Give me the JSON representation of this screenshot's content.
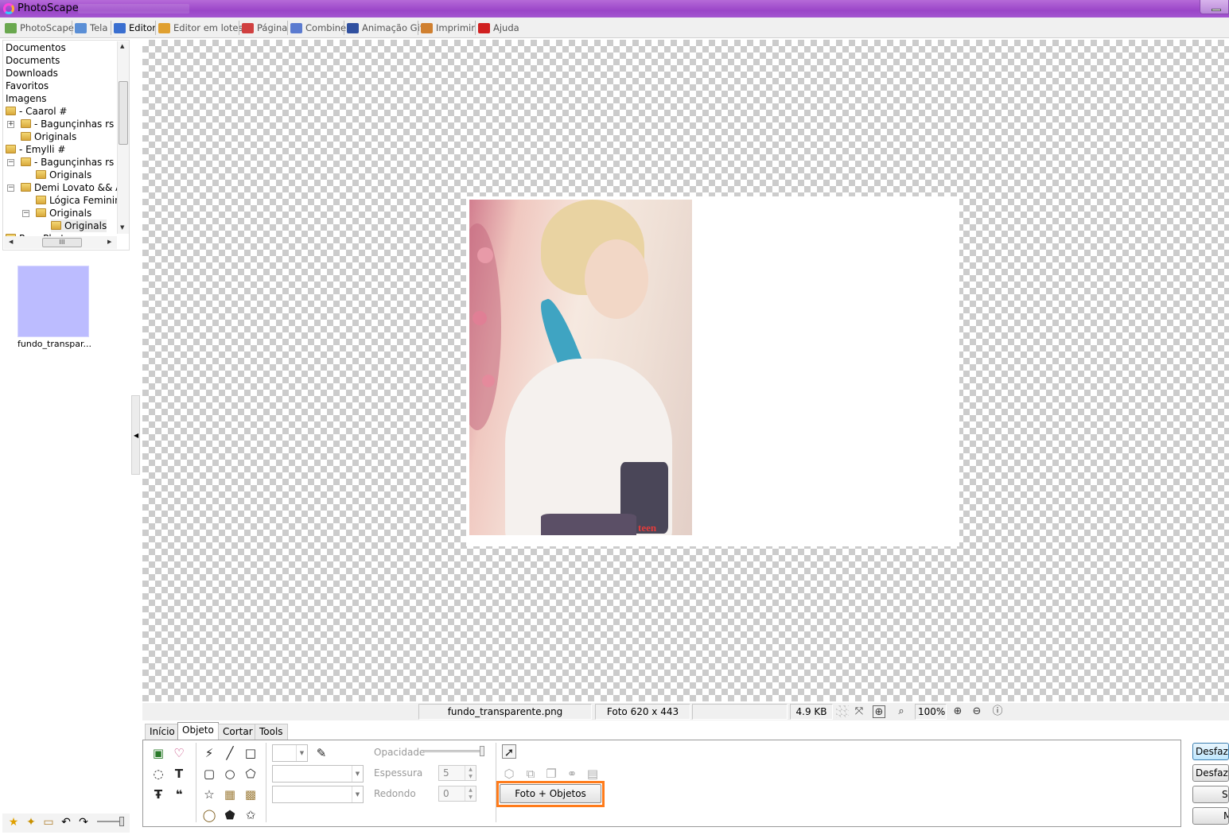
{
  "window": {
    "title": "PhotoScape"
  },
  "tabs": [
    {
      "label": "PhotoScape",
      "icon": "photoscape-icon",
      "color": "#6aa84f"
    },
    {
      "label": "Tela",
      "icon": "viewer-icon",
      "color": "#5b8fd6"
    },
    {
      "label": "Editor",
      "icon": "editor-icon",
      "color": "#3a6fd0"
    },
    {
      "label": "Editor em lotes",
      "icon": "batch-editor-icon",
      "color": "#e0a030"
    },
    {
      "label": "Página",
      "icon": "page-icon",
      "color": "#d04040"
    },
    {
      "label": "Combine",
      "icon": "combine-icon",
      "color": "#5b7bd0"
    },
    {
      "label": "Animação Gif",
      "icon": "gif-icon",
      "color": "#3050a0"
    },
    {
      "label": "Imprimir",
      "icon": "print-icon",
      "color": "#d08030"
    },
    {
      "label": "Ajuda",
      "icon": "help-icon",
      "color": "#d02020"
    }
  ],
  "active_tab": "Editor",
  "tree": {
    "items": [
      {
        "label": "Documentos"
      },
      {
        "label": "Documents"
      },
      {
        "label": "Downloads"
      },
      {
        "label": "Favoritos"
      },
      {
        "label": "Imagens"
      },
      {
        "label": "- Caarol #"
      },
      {
        "label": "- Bagunçinhas rs"
      },
      {
        "label": "Originals"
      },
      {
        "label": "- Emylli #"
      },
      {
        "label": "- Bagunçinhas rs '"
      },
      {
        "label": "Originals"
      },
      {
        "label": "Demi Lovato && A"
      },
      {
        "label": "Lógica Feminina"
      },
      {
        "label": "Originals"
      },
      {
        "label": "Originals"
      },
      {
        "label": "Pmo Photoscape"
      }
    ],
    "hscroll_grip": "III"
  },
  "thumbnail": {
    "caption": "fundo_transpar...",
    "color": "#bcbcff"
  },
  "status": {
    "filename": "fundo_transparente.png",
    "dimensions": "Foto 620 x 443",
    "empty": "",
    "filesize": "4.9 KB",
    "zoom": "100%"
  },
  "bottom_tabs": [
    "Início",
    "Objeto",
    "Cortar",
    "Tools"
  ],
  "active_bottom_tab": "Objeto",
  "object_panel": {
    "opacity_label": "Opacidade",
    "thickness_label": "Espessura",
    "thickness_value": "5",
    "round_label": "Redondo",
    "round_value": "0",
    "photo_objects_button": "Foto + Objetos"
  },
  "right_buttons": [
    "Desfazer",
    "Desfazer tudo",
    "Salvar",
    "Menu"
  ],
  "photo_watermark": "teen VOGUE"
}
